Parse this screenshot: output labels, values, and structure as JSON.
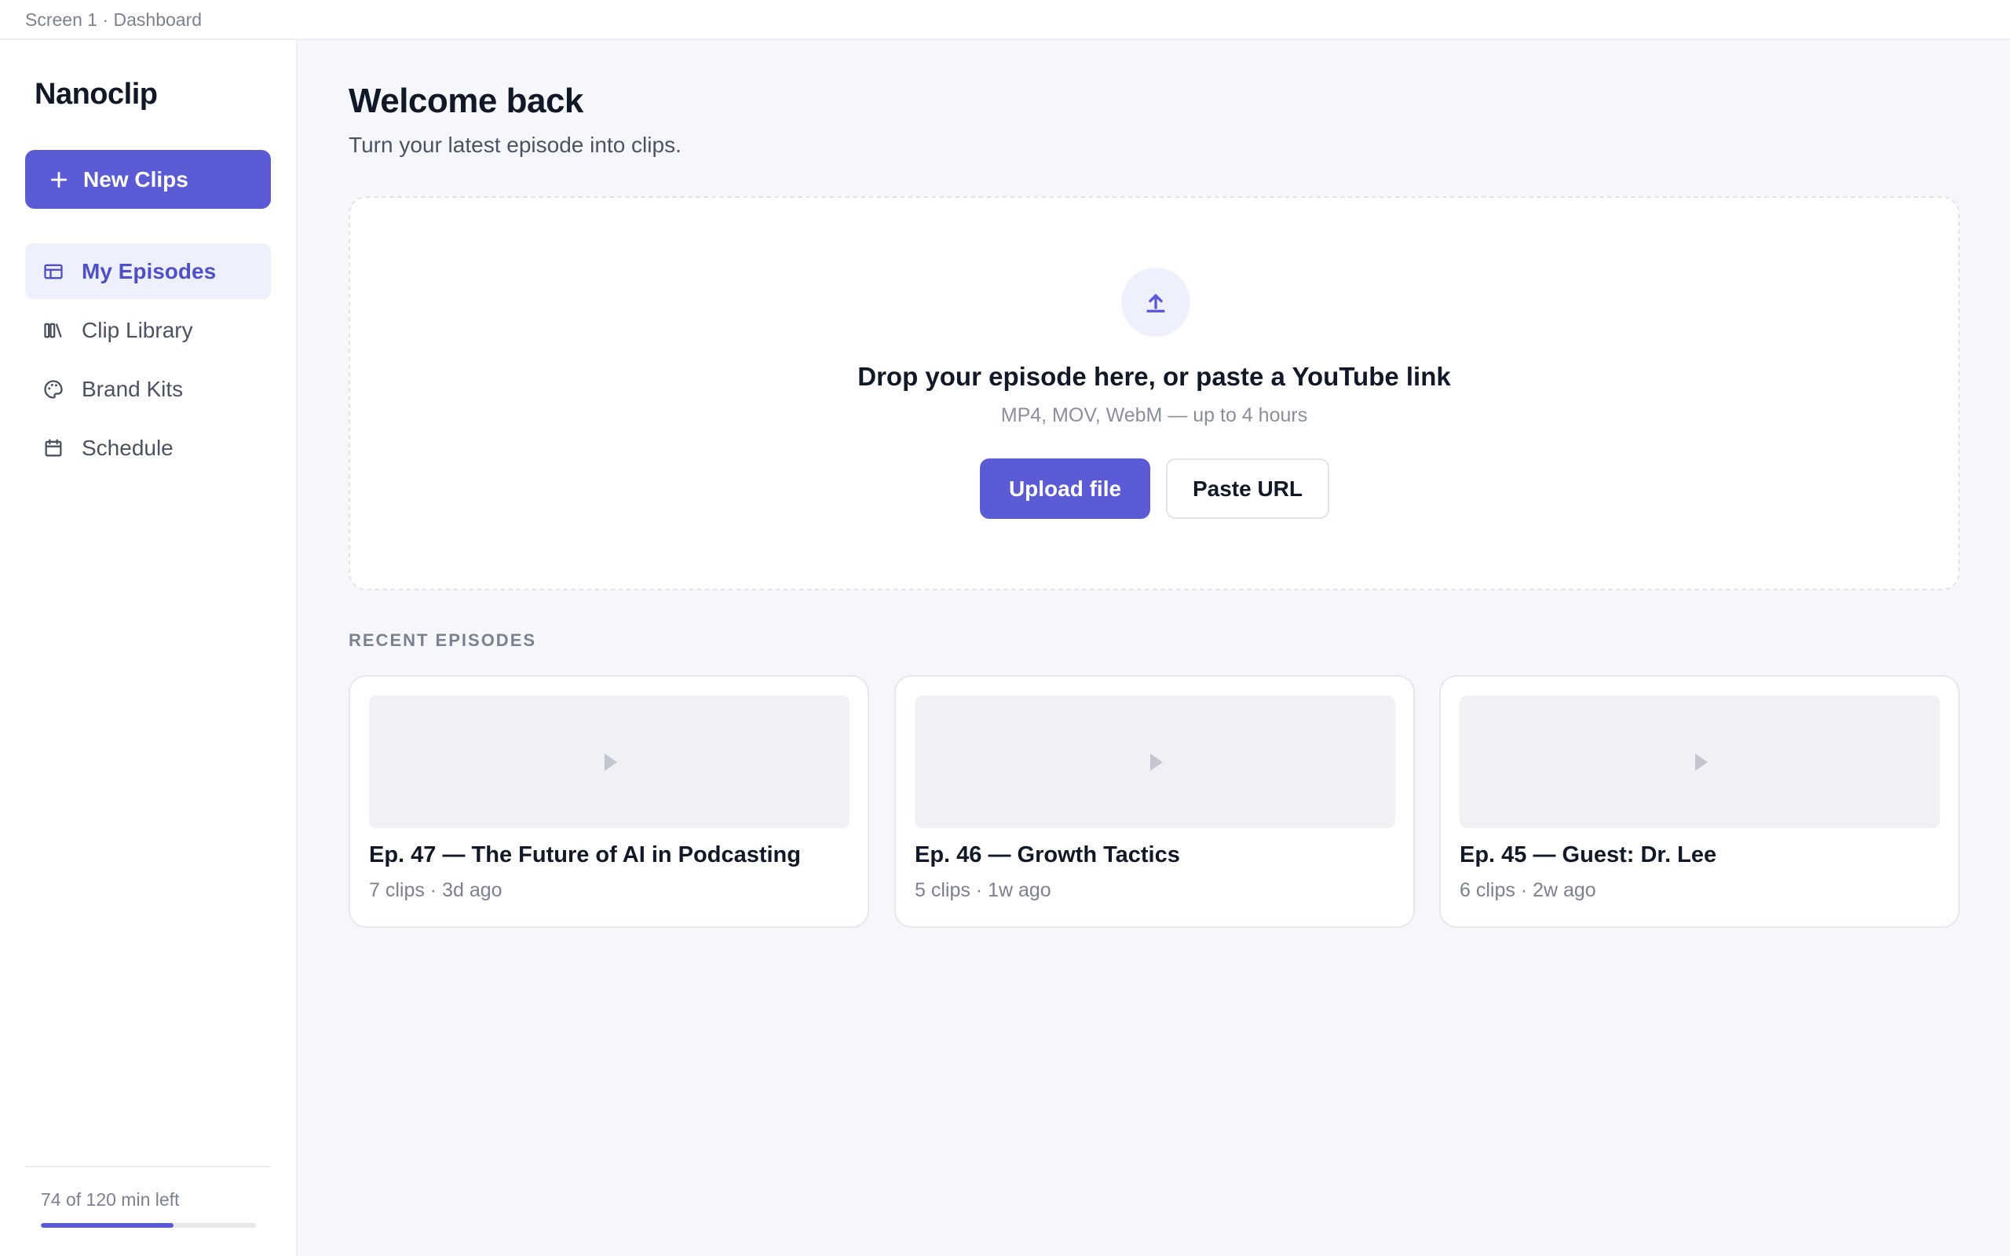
{
  "topbar": {
    "label": "Screen 1 · Dashboard"
  },
  "sidebar": {
    "brand": "Nanoclip",
    "new_clips_label": "New Clips",
    "items": [
      {
        "label": "My Episodes",
        "icon": "table-icon",
        "active": true
      },
      {
        "label": "Clip Library",
        "icon": "library-icon",
        "active": false
      },
      {
        "label": "Brand Kits",
        "icon": "palette-icon",
        "active": false
      },
      {
        "label": "Schedule",
        "icon": "calendar-icon",
        "active": false
      }
    ],
    "usage": {
      "label": "74 of 120 min left",
      "used_fraction": 0.617
    }
  },
  "main": {
    "title": "Welcome back",
    "subtitle": "Turn your latest episode into clips.",
    "dropzone": {
      "icon": "upload-icon",
      "title": "Drop your episode here, or paste a YouTube link",
      "hint": "MP4, MOV, WebM — up to 4 hours",
      "upload_label": "Upload file",
      "paste_label": "Paste URL"
    },
    "recent_label": "RECENT EPISODES",
    "episodes": [
      {
        "title": "Ep. 47 — The Future of AI in Podcasting",
        "meta": "7 clips · 3d ago"
      },
      {
        "title": "Ep. 46 — Growth Tactics",
        "meta": "5 clips · 1w ago"
      },
      {
        "title": "Ep. 45 — Guest: Dr. Lee",
        "meta": "6 clips · 2w ago"
      }
    ]
  },
  "colors": {
    "accent": "#5b5bd6",
    "active_bg": "#eef0fd",
    "background": "#f6f7fb"
  }
}
